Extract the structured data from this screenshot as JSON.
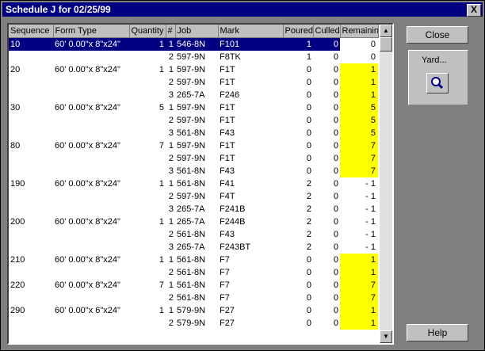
{
  "window": {
    "title": "Schedule J for 02/25/99",
    "close_glyph": "X"
  },
  "columns": [
    "Sequence",
    "Form Type",
    "Quantity",
    "#",
    "Job",
    "Mark",
    "Poured",
    "Culled",
    "Remaining"
  ],
  "rows": [
    {
      "seq": "10",
      "form": "60' 0.00\"x 8\"x24\"",
      "qty": "1",
      "idx": "1",
      "job": "546-8N",
      "mark": "F101",
      "poured": "1",
      "culled": "0",
      "remaining": "0",
      "highlight": false,
      "selected": true
    },
    {
      "seq": "",
      "form": "",
      "qty": "",
      "idx": "2",
      "job": "597-9N",
      "mark": "F8TK",
      "poured": "1",
      "culled": "0",
      "remaining": "0",
      "highlight": false
    },
    {
      "seq": "20",
      "form": "60' 0.00\"x 8\"x24\"",
      "qty": "1",
      "idx": "1",
      "job": "597-9N",
      "mark": "F1T",
      "poured": "0",
      "culled": "0",
      "remaining": "1",
      "highlight": true
    },
    {
      "seq": "",
      "form": "",
      "qty": "",
      "idx": "2",
      "job": "597-9N",
      "mark": "F1T",
      "poured": "0",
      "culled": "0",
      "remaining": "1",
      "highlight": true
    },
    {
      "seq": "",
      "form": "",
      "qty": "",
      "idx": "3",
      "job": "265-7A",
      "mark": "F246",
      "poured": "0",
      "culled": "0",
      "remaining": "1",
      "highlight": true
    },
    {
      "seq": "30",
      "form": "60' 0.00\"x 8\"x24\"",
      "qty": "5",
      "idx": "1",
      "job": "597-9N",
      "mark": "F1T",
      "poured": "0",
      "culled": "0",
      "remaining": "5",
      "highlight": true
    },
    {
      "seq": "",
      "form": "",
      "qty": "",
      "idx": "2",
      "job": "597-9N",
      "mark": "F1T",
      "poured": "0",
      "culled": "0",
      "remaining": "5",
      "highlight": true
    },
    {
      "seq": "",
      "form": "",
      "qty": "",
      "idx": "3",
      "job": "561-8N",
      "mark": "F43",
      "poured": "0",
      "culled": "0",
      "remaining": "5",
      "highlight": true
    },
    {
      "seq": "80",
      "form": "60' 0.00\"x 8\"x24\"",
      "qty": "7",
      "idx": "1",
      "job": "597-9N",
      "mark": "F1T",
      "poured": "0",
      "culled": "0",
      "remaining": "7",
      "highlight": true
    },
    {
      "seq": "",
      "form": "",
      "qty": "",
      "idx": "2",
      "job": "597-9N",
      "mark": "F1T",
      "poured": "0",
      "culled": "0",
      "remaining": "7",
      "highlight": true
    },
    {
      "seq": "",
      "form": "",
      "qty": "",
      "idx": "3",
      "job": "561-8N",
      "mark": "F43",
      "poured": "0",
      "culled": "0",
      "remaining": "7",
      "highlight": true
    },
    {
      "seq": "190",
      "form": "60' 0.00\"x 8\"x24\"",
      "qty": "1",
      "idx": "1",
      "job": "561-8N",
      "mark": "F41",
      "poured": "2",
      "culled": "0",
      "remaining": "- 1",
      "highlight": false
    },
    {
      "seq": "",
      "form": "",
      "qty": "",
      "idx": "2",
      "job": "597-9N",
      "mark": "F4T",
      "poured": "2",
      "culled": "0",
      "remaining": "- 1",
      "highlight": false
    },
    {
      "seq": "",
      "form": "",
      "qty": "",
      "idx": "3",
      "job": "265-7A",
      "mark": "F241B",
      "poured": "2",
      "culled": "0",
      "remaining": "- 1",
      "highlight": false
    },
    {
      "seq": "200",
      "form": "60' 0.00\"x 8\"x24\"",
      "qty": "1",
      "idx": "1",
      "job": "265-7A",
      "mark": "F244B",
      "poured": "2",
      "culled": "0",
      "remaining": "- 1",
      "highlight": false
    },
    {
      "seq": "",
      "form": "",
      "qty": "",
      "idx": "2",
      "job": "561-8N",
      "mark": "F43",
      "poured": "2",
      "culled": "0",
      "remaining": "- 1",
      "highlight": false
    },
    {
      "seq": "",
      "form": "",
      "qty": "",
      "idx": "3",
      "job": "265-7A",
      "mark": "F243BT",
      "poured": "2",
      "culled": "0",
      "remaining": "- 1",
      "highlight": false
    },
    {
      "seq": "210",
      "form": "60' 0.00\"x 8\"x24\"",
      "qty": "1",
      "idx": "1",
      "job": "561-8N",
      "mark": "F7",
      "poured": "0",
      "culled": "0",
      "remaining": "1",
      "highlight": true
    },
    {
      "seq": "",
      "form": "",
      "qty": "",
      "idx": "2",
      "job": "561-8N",
      "mark": "F7",
      "poured": "0",
      "culled": "0",
      "remaining": "1",
      "highlight": true
    },
    {
      "seq": "220",
      "form": "60' 0.00\"x 8\"x24\"",
      "qty": "7",
      "idx": "1",
      "job": "561-8N",
      "mark": "F7",
      "poured": "0",
      "culled": "0",
      "remaining": "7",
      "highlight": true
    },
    {
      "seq": "",
      "form": "",
      "qty": "",
      "idx": "2",
      "job": "561-8N",
      "mark": "F7",
      "poured": "0",
      "culled": "0",
      "remaining": "7",
      "highlight": true
    },
    {
      "seq": "290",
      "form": "60' 0.00\"x 6\"x24\"",
      "qty": "1",
      "idx": "1",
      "job": "579-9N",
      "mark": "F27",
      "poured": "0",
      "culled": "0",
      "remaining": "1",
      "highlight": true
    },
    {
      "seq": "",
      "form": "",
      "qty": "",
      "idx": "2",
      "job": "579-9N",
      "mark": "F27",
      "poured": "0",
      "culled": "0",
      "remaining": "1",
      "highlight": true
    }
  ],
  "buttons": {
    "close": "Close",
    "yard": "Yard...",
    "help": "Help"
  },
  "icons": {
    "yard_search": "magnifier-icon",
    "scroll_up": "arrow-up-icon",
    "scroll_down": "arrow-down-icon"
  },
  "colors": {
    "highlight": "#ffff00",
    "selection": "#000080",
    "title": "#000080"
  }
}
